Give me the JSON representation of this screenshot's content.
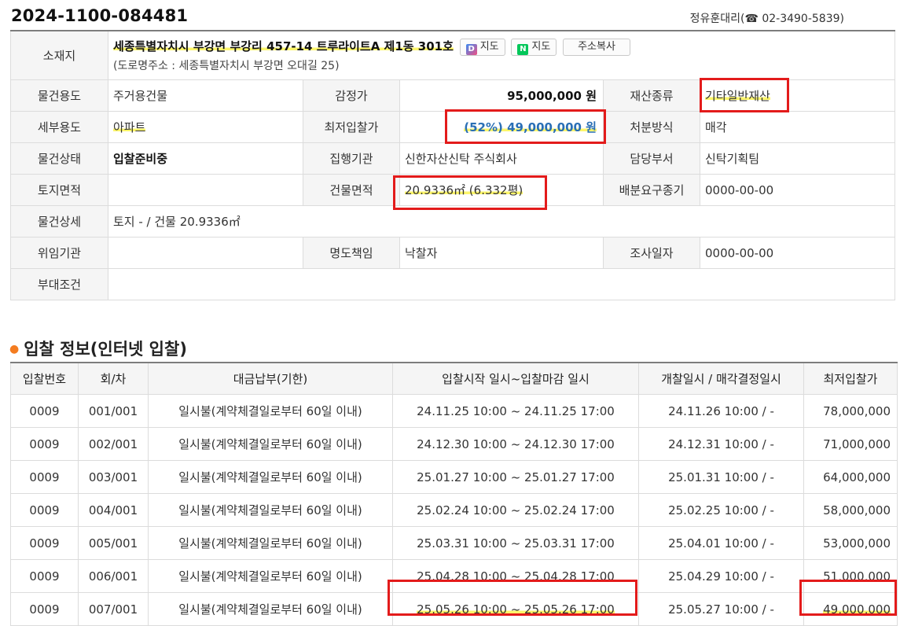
{
  "header": {
    "case_number": "2024-1100-084481",
    "agent_name": "정유훈대리",
    "phone_icon": "phone-icon",
    "phone_glyph": "☎",
    "phone_number": "02-3490-5839"
  },
  "location": {
    "label": "소재지",
    "address": "세종특별자치시 부강면 부강리 457-14 트루라이트A 제1동 301호",
    "road_address": "(도로명주소 : 세종특별자치시 부강면 오대길 25)",
    "daum_map_icon": "D",
    "naver_map_icon": "N",
    "daum_map_label": "지도",
    "naver_map_label": "지도",
    "copy_label": "주소복사"
  },
  "details": {
    "usage_label": "물건용도",
    "usage": "주거용건물",
    "appraisal_label": "감정가",
    "appraisal": "95,000,000 원",
    "asset_type_label": "재산종류",
    "asset_type": "기타일반재산",
    "sub_usage_label": "세부용도",
    "sub_usage": "아파트",
    "min_bid_label": "최저입찰가",
    "min_bid": "(52%) 49,000,000 원",
    "disposal_label": "처분방식",
    "disposal": "매각",
    "status_label": "물건상태",
    "status": "입찰준비중",
    "executor_label": "집행기관",
    "executor": "신한자산신탁 주식회사",
    "department_label": "담당부서",
    "department": "신탁기획팀",
    "land_area_label": "토지면적",
    "land_area": "",
    "building_area_label": "건물면적",
    "building_area": "20.9336㎡ (6.332평)",
    "distribution_label": "배분요구종기",
    "distribution": "0000-00-00",
    "detail_label": "물건상세",
    "detail": "토지 - / 건물 20.9336㎡",
    "delegator_label": "위임기관",
    "delegator": "",
    "eviction_label": "명도책임",
    "eviction": "낙찰자",
    "survey_label": "조사일자",
    "survey": "0000-00-00",
    "conditions_label": "부대조건",
    "conditions": ""
  },
  "bid_section": {
    "title": "입찰 정보(인터넷 입찰)",
    "columns": [
      "입찰번호",
      "회/차",
      "대금납부(기한)",
      "입찰시작 일시~입찰마감 일시",
      "개찰일시 / 매각결정일시",
      "최저입찰가"
    ],
    "rows": [
      {
        "no": "0009",
        "round": "001/001",
        "payment": "일시불(계약체결일로부터 60일 이내)",
        "period": "24.11.25 10:00 ~ 24.11.25 17:00",
        "opening": "24.11.26 10:00 / -",
        "price": "78,000,000"
      },
      {
        "no": "0009",
        "round": "002/001",
        "payment": "일시불(계약체결일로부터 60일 이내)",
        "period": "24.12.30 10:00 ~ 24.12.30 17:00",
        "opening": "24.12.31 10:00 / -",
        "price": "71,000,000"
      },
      {
        "no": "0009",
        "round": "003/001",
        "payment": "일시불(계약체결일로부터 60일 이내)",
        "period": "25.01.27 10:00 ~ 25.01.27 17:00",
        "opening": "25.01.31 10:00 / -",
        "price": "64,000,000"
      },
      {
        "no": "0009",
        "round": "004/001",
        "payment": "일시불(계약체결일로부터 60일 이내)",
        "period": "25.02.24 10:00 ~ 25.02.24 17:00",
        "opening": "25.02.25 10:00 / -",
        "price": "58,000,000"
      },
      {
        "no": "0009",
        "round": "005/001",
        "payment": "일시불(계약체결일로부터 60일 이내)",
        "period": "25.03.31 10:00 ~ 25.03.31 17:00",
        "opening": "25.04.01 10:00 / -",
        "price": "53,000,000"
      },
      {
        "no": "0009",
        "round": "006/001",
        "payment": "일시불(계약체결일로부터 60일 이내)",
        "period": "25.04.28 10:00 ~ 25.04.28 17:00",
        "opening": "25.04.29 10:00 / -",
        "price": "51,000,000"
      },
      {
        "no": "0009",
        "round": "007/001",
        "payment": "일시불(계약체결일로부터 60일 이내)",
        "period": "25.05.26 10:00 ~ 25.05.26 17:00",
        "opening": "25.05.27 10:00 / -",
        "price": "49,000,000"
      }
    ]
  },
  "colors": {
    "highlight_box": "#e31b1b",
    "highlight_marker": "#fdf66a",
    "min_bid_text": "#2a6fb5",
    "section_bullet": "#f47c20"
  }
}
